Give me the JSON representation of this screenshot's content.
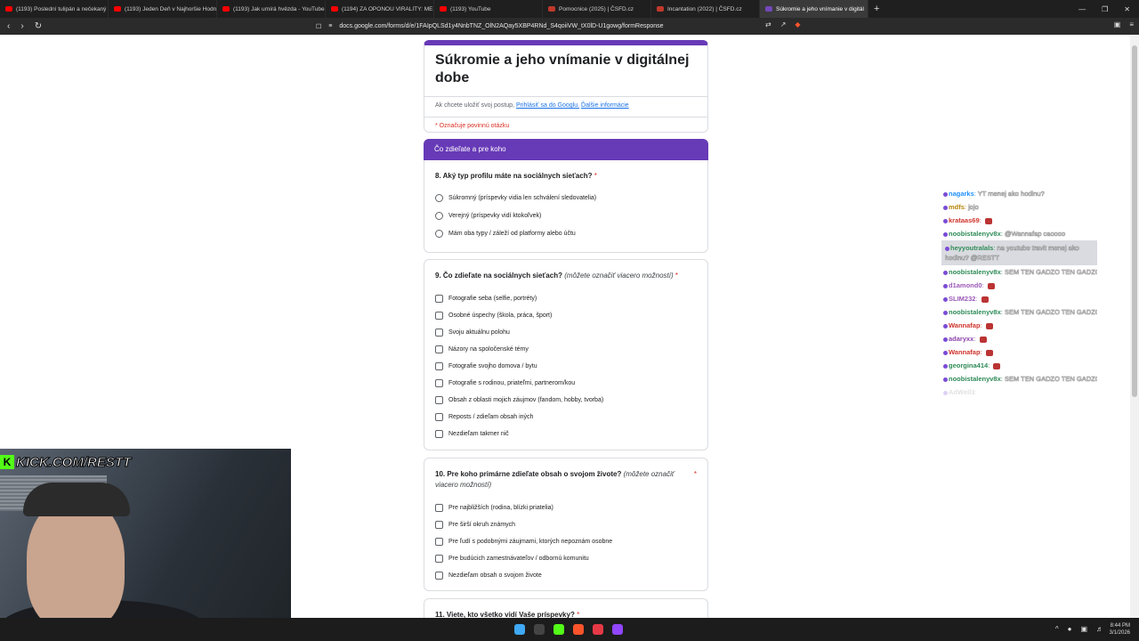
{
  "browser": {
    "tabs": [
      {
        "title": "(1193) Poslední tulipán a nečekaný n",
        "fav_color": "#ff0000"
      },
      {
        "title": "(1193) Jeden Deň v Najhoršie Hodnot",
        "fav_color": "#ff0000"
      },
      {
        "title": "(1193) Jak umírá hvězda - YouTube",
        "fav_color": "#ff0000"
      },
      {
        "title": "(1194) ZA OPONOU VIRALITY: MELI",
        "fav_color": "#ff0000"
      },
      {
        "title": "(1193) YouTube",
        "fav_color": "#ff0000"
      },
      {
        "title": "Pomocnice (2025) | ČSFD.cz",
        "fav_color": "#c0392b"
      },
      {
        "title": "Incantation (2022) | ČSFD.cz",
        "fav_color": "#c0392b"
      },
      {
        "title": "Súkromie a jeho vnímanie v digitál",
        "fav_color": "#7248b9"
      }
    ],
    "url": "docs.google.com/forms/d/e/1FAIpQLSd1y4NnbTNZ_OlN2AQay5XBP4RNd_S4qoiiVW_tX0lD-U1gowg/formResponse"
  },
  "form": {
    "title": "Súkromie a jeho vnímanie v digitálnej dobe",
    "signin_text": "Ak chcete uložiť svoj postup, ",
    "signin_link": "Prihlásiť sa do Googlu.",
    "more_info": "Ďalšie informácie",
    "required_note": "* Označuje povinnú otázku",
    "section_title": "Čo zdieľate a pre koho",
    "q8": {
      "title": "8. Aký typ profilu máte na sociálnych sieťach?",
      "star": "*",
      "options": [
        "Súkromný (príspevky vidia len schválení sledovatelia)",
        "Verejný (príspevky vidí ktokoľvek)",
        "Mám oba typy / záleží od platformy alebo účtu"
      ]
    },
    "q9": {
      "title": "9. Čo zdieľate na sociálnych sieťach?",
      "hint": "(môžete označiť viacero možností)",
      "star": "*",
      "options": [
        "Fotografie seba (selfie, portréty)",
        "Osobné úspechy (škola, práca, šport)",
        "Svoju aktuálnu polohu",
        "Názory na spoločenské témy",
        "Fotografie svojho domova / bytu",
        "Fotografie s rodinou, priateľmi, partnerom/kou",
        "Obsah z oblasti mojich záujmov (fandom, hobby, tvorba)",
        "Reposts / zdieľam obsah iných",
        "Nezdieľam takmer nič"
      ]
    },
    "q10": {
      "title": "10. Pre koho primárne zdieľate obsah o svojom živote?",
      "hint": "(môžete označiť viacero možností)",
      "star": "*",
      "options": [
        "Pre najbližších (rodina, blízki priatelia)",
        "Pre širší okruh známych",
        "Pre ľudí s podobnými záujmami, ktorých nepoznám osobne",
        "Pre budúcich zamestnávateľov / odbornú komunitu",
        "Nezdieľam obsah o svojom živote"
      ]
    },
    "q11": {
      "title": "11. Viete, kto všetko vidí Vaše príspevky?",
      "star": "*"
    }
  },
  "chat": [
    {
      "user": "nagarks",
      "color": "#1e90ff",
      "msg": "YT menej ako hodinu?"
    },
    {
      "user": "mdfs",
      "color": "#b8860b",
      "msg": "jojo"
    },
    {
      "user": "krataas69",
      "color": "#d0342c",
      "msg": ""
    },
    {
      "user": "noobistalenyv8x",
      "color": "#2e8b57",
      "msg": "@Wannafap caoooo"
    },
    {
      "user": "heyyoutralals",
      "color": "#2e8b57",
      "msg": "na youtube travit menej ako hodinu? @RESTT",
      "highlight": true
    },
    {
      "user": "noobistalenyv8x",
      "color": "#2e8b57",
      "msg": "SEM TEN GADZO TEN GADZO"
    },
    {
      "user": "d1amond0",
      "color": "#9b59b6",
      "msg": ""
    },
    {
      "user": "SLIM232",
      "color": "#9b59b6",
      "msg": ""
    },
    {
      "user": "noobistalenyv8x",
      "color": "#2e8b57",
      "msg": "SEM TEN GADZO TEN GADZO"
    },
    {
      "user": "Wannafap",
      "color": "#d0342c",
      "msg": ""
    },
    {
      "user": "adaryxx",
      "color": "#8e44ad",
      "msg": ""
    },
    {
      "user": "Wannafap",
      "color": "#d0342c",
      "msg": ""
    },
    {
      "user": "georgina414",
      "color": "#2e8b57",
      "msg": ""
    },
    {
      "user": "noobistalenyv8x",
      "color": "#2e8b57",
      "msg": "SEM TEN GADZO TEN GADZO"
    },
    {
      "user": "AdWell3",
      "color": "#888",
      "msg": "",
      "fade": true
    }
  ],
  "stream": {
    "overlay": "KICK.COM/RESTT",
    "k": "K"
  },
  "taskbar": {
    "time": "8:44 PM",
    "date": "3/1/2026"
  }
}
